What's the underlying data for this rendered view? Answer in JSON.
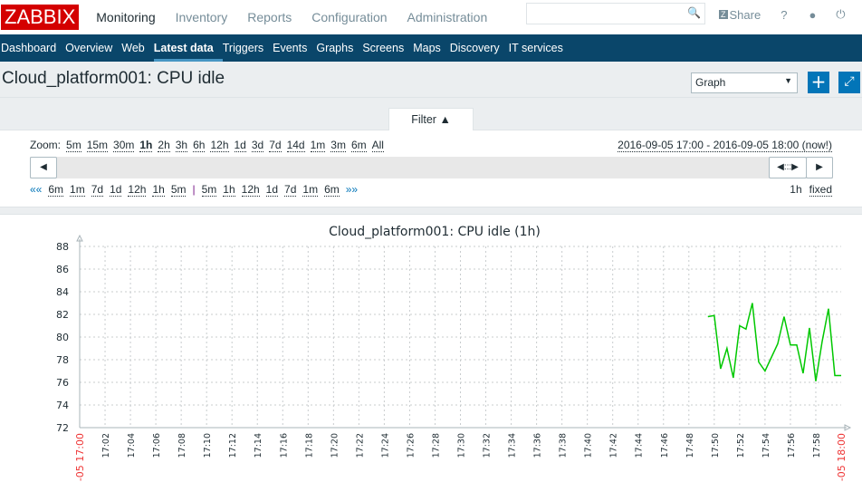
{
  "logo": "ZABBIX",
  "main_nav": [
    "Monitoring",
    "Inventory",
    "Reports",
    "Configuration",
    "Administration"
  ],
  "search": {
    "placeholder": ""
  },
  "tools": {
    "share": "Share",
    "help": "?"
  },
  "sub_nav": [
    "Dashboard",
    "Overview",
    "Web",
    "Latest data",
    "Triggers",
    "Events",
    "Graphs",
    "Screens",
    "Maps",
    "Discovery",
    "IT services"
  ],
  "page_title": "Cloud_platform001: CPU idle",
  "view_select": "Graph",
  "filter": {
    "tab": "Filter ▲",
    "zoom_label": "Zoom:",
    "zoom": [
      "5m",
      "15m",
      "30m",
      "1h",
      "2h",
      "3h",
      "6h",
      "12h",
      "1d",
      "3d",
      "7d",
      "14d",
      "1m",
      "3m",
      "6m",
      "All"
    ],
    "zoom_active": "1h",
    "range": "2016-09-05 17:00 - 2016-09-05 18:00 (now!)",
    "back": [
      "««",
      "6m",
      "1m",
      "7d",
      "1d",
      "12h",
      "1h",
      "5m"
    ],
    "sep": "|",
    "fwd": [
      "5m",
      "1h",
      "12h",
      "1d",
      "7d",
      "1m",
      "6m",
      "»»"
    ],
    "period": "1h",
    "fixed": "fixed"
  },
  "chart_data": {
    "type": "line",
    "title": "Cloud_platform001: CPU idle (1h)",
    "ylim": [
      72,
      88
    ],
    "yticks": [
      72,
      74,
      76,
      78,
      80,
      82,
      84,
      86,
      88
    ],
    "xlim": [
      "17:00",
      "18:00"
    ],
    "xticks": [
      "-05 17:00",
      "17:02",
      "17:04",
      "17:06",
      "17:08",
      "17:10",
      "17:12",
      "17:14",
      "17:16",
      "17:18",
      "17:20",
      "17:22",
      "17:24",
      "17:26",
      "17:28",
      "17:30",
      "17:32",
      "17:34",
      "17:36",
      "17:38",
      "17:40",
      "17:42",
      "17:44",
      "17:46",
      "17:48",
      "17:50",
      "17:52",
      "17:54",
      "17:56",
      "17:58",
      "-05 18:00"
    ],
    "grid": true,
    "color": "#00c800",
    "series": [
      {
        "x": [
          "17:49:30",
          "17:50:00",
          "17:50:30",
          "17:51:00",
          "17:51:30",
          "17:52:00",
          "17:52:30",
          "17:53:00",
          "17:53:30",
          "17:54:00",
          "17:54:30",
          "17:55:00",
          "17:55:30",
          "17:56:00",
          "17:56:30",
          "17:57:00",
          "17:57:30",
          "17:58:00",
          "17:58:30",
          "17:59:00",
          "17:59:30",
          "18:00:00"
        ],
        "values": [
          81.8,
          81.9,
          77.2,
          79.0,
          76.4,
          81.0,
          80.7,
          83.0,
          77.8,
          77.0,
          78.2,
          79.4,
          81.8,
          79.3,
          79.3,
          76.8,
          80.8,
          76.1,
          79.6,
          82.5,
          76.6,
          76.6
        ]
      }
    ]
  }
}
